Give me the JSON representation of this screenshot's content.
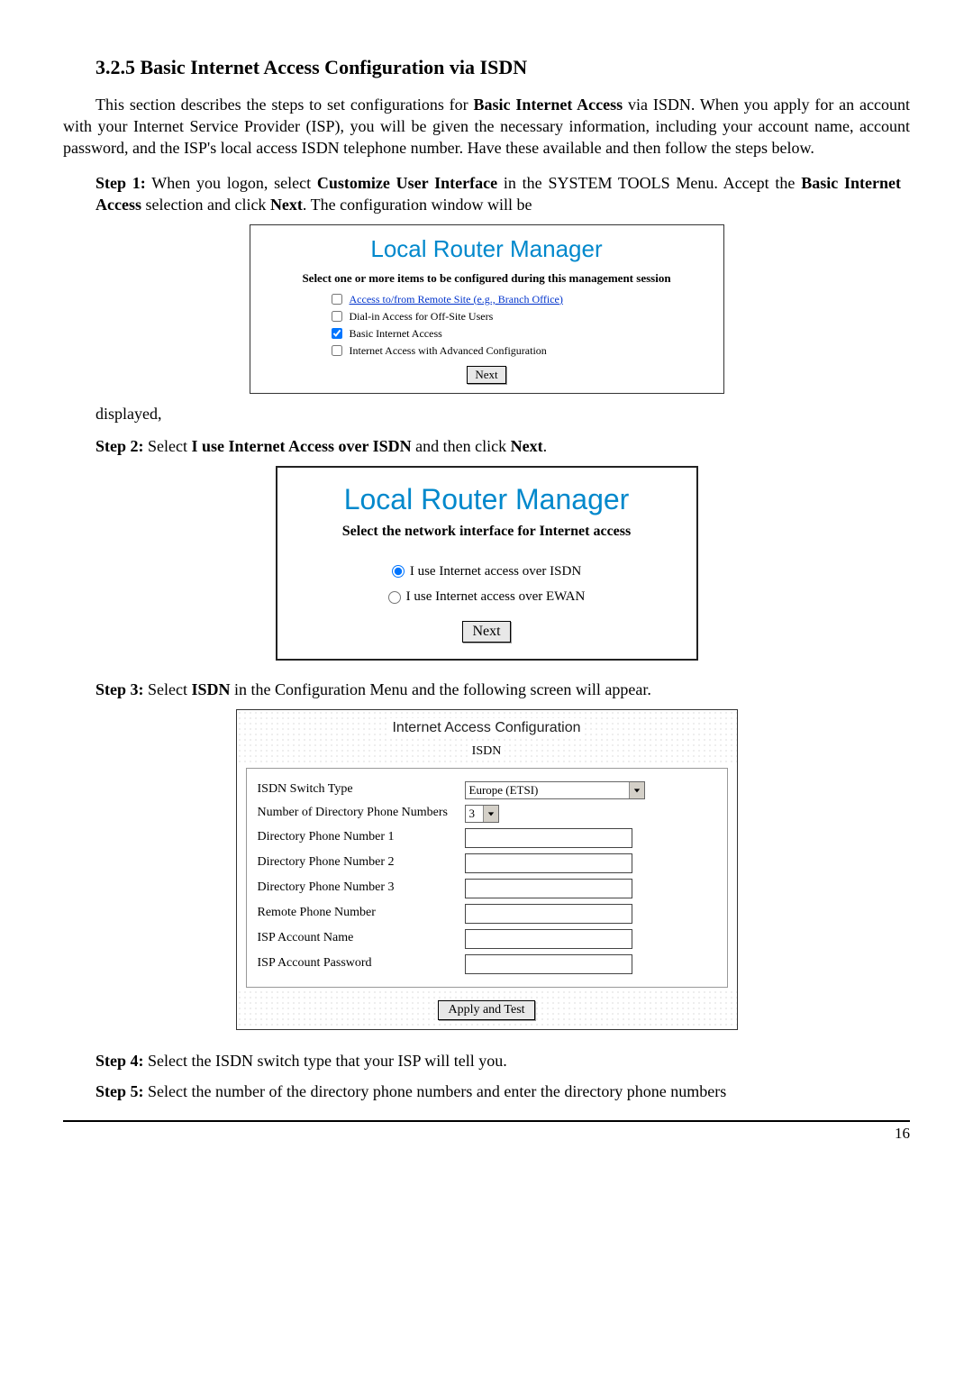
{
  "section_number": "3.2.5",
  "section_title": "Basic Internet Access Configuration via ISDN",
  "intro": {
    "pre1": "This section describes the steps to set configurations for ",
    "bold1": "Basic Internet Access",
    "post1": " via ISDN. When you apply for an account with your Internet Service Provider (ISP), you will be given the necessary information, including your account name, account password, and the ISP's local access ISDN telephone number. Have these available and then follow the steps below."
  },
  "step1": {
    "label": "Step 1:",
    "t1": " When you logon, select ",
    "b1": "Customize User Interface",
    "t2": " in the SYSTEM TOOLS Menu. Accept the ",
    "b2": "Basic Internet Access",
    "t3": " selection and click ",
    "b3": "Next",
    "t4": ". The configuration window will be"
  },
  "displayed_word": "displayed,",
  "panel1": {
    "title": "Local Router Manager",
    "heading": "Select one or more items to be configured during this management session",
    "items": [
      {
        "label": "Access to/from Remote Site (e.g., Branch Office)",
        "checked": false,
        "link": true
      },
      {
        "label": "Dial-in Access for Off-Site Users",
        "checked": false,
        "link": false
      },
      {
        "label": "Basic Internet Access",
        "checked": true,
        "link": false
      },
      {
        "label": "Internet Access with Advanced Configuration",
        "checked": false,
        "link": false
      }
    ],
    "next_btn": "Next"
  },
  "step2": {
    "label": "Step 2:",
    "t1": " Select ",
    "b1": "I use Internet Access over ISDN",
    "t2": " and then click ",
    "b2": "Next",
    "t3": "."
  },
  "panel2": {
    "title": "Local Router Manager",
    "sub": "Select the network interface for Internet access",
    "radios": [
      {
        "label": "I use Internet access over ISDN",
        "selected": true
      },
      {
        "label": "I use Internet access over EWAN",
        "selected": false
      }
    ],
    "next_btn": "Next"
  },
  "step3": {
    "label": "Step 3:",
    "t1": " Select ",
    "b1": "ISDN",
    "t2": " in the Configuration Menu and the following screen will appear."
  },
  "panel3": {
    "top_title": "Internet Access Configuration",
    "top_sub": "ISDN",
    "rows": {
      "switch_type_label": "ISDN Switch Type",
      "switch_type_value": "Europe (ETSI)",
      "num_dir_label": "Number of Directory Phone Numbers",
      "num_dir_value": "3",
      "dir1": "Directory Phone Number 1",
      "dir2": "Directory Phone Number 2",
      "dir3": "Directory Phone Number 3",
      "remote": "Remote Phone Number",
      "acct_name": "ISP Account Name",
      "acct_pass": "ISP Account Password"
    },
    "apply_btn": "Apply and Test"
  },
  "step4": {
    "label": "Step 4:",
    "text": " Select the ISDN switch type that your ISP will tell you."
  },
  "step5": {
    "label": "Step 5:",
    "text": " Select the number of the directory phone numbers and enter the directory phone numbers"
  },
  "page_number": "16"
}
